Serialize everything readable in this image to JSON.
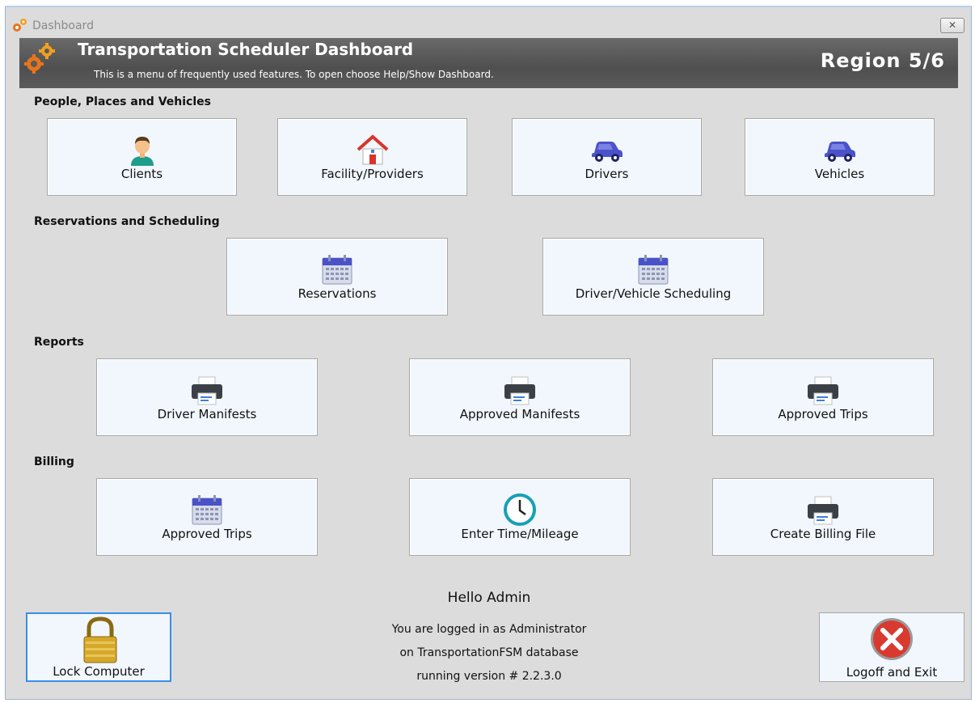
{
  "window": {
    "title": "Dashboard",
    "close_label": "✕"
  },
  "banner": {
    "title": "Transportation Scheduler Dashboard",
    "subtitle": "This is a menu of frequently used features. To open choose Help/Show Dashboard.",
    "region": "Region 5/6"
  },
  "sections": {
    "people": "People, Places and Vehicles",
    "reservations": "Reservations and Scheduling",
    "reports": "Reports",
    "billing": "Billing"
  },
  "tiles": {
    "clients": {
      "label": "Clients",
      "icon": "person-icon"
    },
    "facility": {
      "label": "Facility/Providers",
      "icon": "house-icon"
    },
    "drivers": {
      "label": "Drivers",
      "icon": "car-icon"
    },
    "vehicles": {
      "label": "Vehicles",
      "icon": "car-icon"
    },
    "reservations": {
      "label": "Reservations",
      "icon": "calendar-icon"
    },
    "scheduling": {
      "label": "Driver/Vehicle Scheduling",
      "icon": "calendar-icon"
    },
    "driver_manifests": {
      "label": "Driver Manifests",
      "icon": "printer-icon"
    },
    "approved_manifests": {
      "label": "Approved Manifests",
      "icon": "printer-icon"
    },
    "approved_trips_report": {
      "label": "Approved Trips",
      "icon": "printer-icon"
    },
    "approved_trips_billing": {
      "label": "Approved Trips",
      "icon": "calendar-icon"
    },
    "time_mileage": {
      "label": "Enter Time/Mileage",
      "icon": "clock-icon"
    },
    "billing_file": {
      "label": "Create Billing File",
      "icon": "printer-icon"
    }
  },
  "footer": {
    "greeting": "Hello Admin",
    "line1": "You are logged in as Administrator",
    "line2": "on TransportationFSM database",
    "line3": "running version # 2.2.3.0",
    "lock_label": "Lock Computer",
    "logoff_label": "Logoff and Exit"
  },
  "colors": {
    "banner": "#5a5a5a",
    "tile_bg": "#f1f7fd",
    "icon_blue": "#4a52c9",
    "house_red": "#d9342b",
    "gear_orange": "#e8741c",
    "focus_border": "#3a8ee6"
  }
}
